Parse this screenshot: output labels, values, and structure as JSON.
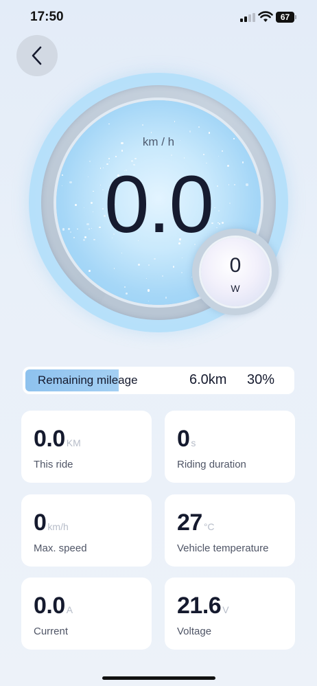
{
  "status_bar": {
    "time": "17:50",
    "battery": "67"
  },
  "speedometer": {
    "unit": "km / h",
    "value": "0.0"
  },
  "power": {
    "value": "0",
    "unit": "W"
  },
  "mileage": {
    "label": "Remaining mileage",
    "distance": "6.0km",
    "percent_text": "30%",
    "fill_fraction": 0.35
  },
  "stats": [
    {
      "value": "0.0",
      "unit": "KM",
      "label": "This ride"
    },
    {
      "value": "0",
      "unit": "s",
      "label": "Riding duration"
    },
    {
      "value": "0",
      "unit": "km/h",
      "label": "Max. speed"
    },
    {
      "value": "27",
      "unit": "°C",
      "label": "Vehicle temperature"
    },
    {
      "value": "0.0",
      "unit": "A",
      "label": "Current"
    },
    {
      "value": "21.6",
      "unit": "V",
      "label": "Voltage"
    }
  ],
  "icons": {
    "back": "chevron-left-icon",
    "signal": "signal-icon",
    "wifi": "wifi-icon",
    "battery": "battery-icon"
  }
}
